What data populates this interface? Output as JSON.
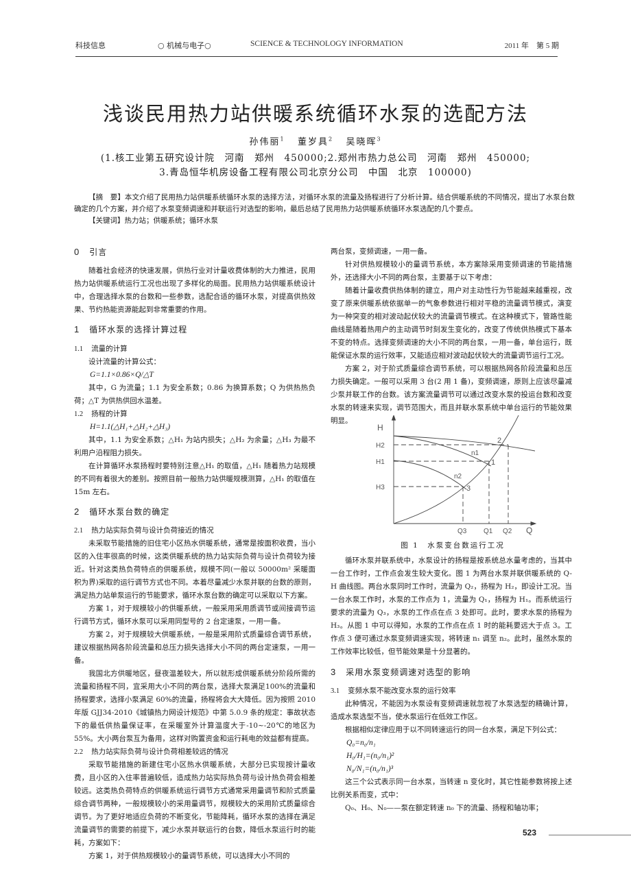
{
  "header": {
    "journal_cn": "科技信息",
    "section": "○ 机械与电子○",
    "journal_en": "SCIENCE & TECHNOLOGY INFORMATION",
    "issue": "2011 年　第 5 期"
  },
  "article": {
    "title": "浅谈民用热力站供暖系统循环水泵的选配方法",
    "authors": [
      {
        "name": "孙伟丽",
        "sup": "1"
      },
      {
        "name": "董岁具",
        "sup": "2"
      },
      {
        "name": "吴晓晖",
        "sup": "3"
      }
    ],
    "affiliation_line1": "(1.核工业第五研究设计院　河南　郑州　450000;2.郑州市热力总公司　河南　郑州　450000;",
    "affiliation_line2": "3.青岛恒华机房设备工程有限公司北京分公司　中国　北京　100000)",
    "abstract_label": "【摘　要】",
    "abstract": "本文介绍了民用热力站供暖系统循环水泵的选择方法，对循环水泵的流量及扬程进行了分析计算。结合供暖系统的不同情况，提出了水泵台数确定的几个方案，并介绍了水泵变频调速和并联运行对选型的影响，最后总结了民用热力站供暖系统循环水泵选配的几个要点。",
    "keywords_label": "【关键词】",
    "keywords": "热力站；供暖系统；循环水泵"
  },
  "left_column": {
    "s0_num": "0",
    "s0_title": "引言",
    "s0_p1": "随着社会经济的快速发展，供热行业对计量收费体制的大力推进，民用热力站供暖系统运行工况也出现了多样化的局面。民用热力站供暖系统设计中，合理选择水泵的台数和一些参数，选配合适的循环水泵，对提高供热效果、节约热能资源能起到非常重要的作用。",
    "s1_num": "1",
    "s1_title": "循环水泵的选择计算过程",
    "s11_num": "1.1",
    "s11_title": "流量的计算",
    "s11_p1": "设计流量的计算公式：",
    "s11_formula": "G=1.1×0.86×Q/△T",
    "s11_p2": "其中，G 为流量；1.1 为安全系数；0.86 为换算系数；Q 为供热热负荷；△T 为供热供回水温差。",
    "s12_num": "1.2",
    "s12_title": "扬程的计算",
    "s12_formula": "H=1.1(△H₁+△H₂+△H₃)",
    "s12_p1": "其中，1.1 为安全系数；△H₁ 为站内损失；△H₂ 为余量；△H₃ 为最不利用户沿程阻力损失。",
    "s12_p2": "在计算循环水泵扬程时要特别注意△H₁ 的取值，△H₁ 随着热力站规模的不同有着很大的差别。按照目前一般热力站供暖规模测算，△H₁ 的取值在 15m 左右。",
    "s2_num": "2",
    "s2_title": "循环水泵台数的确定",
    "s21_num": "2.1",
    "s21_title": "热力站实际负荷与设计负荷接近的情况",
    "s21_p1": "未采取节能措施的旧住宅小区热水供暖系统，通常是按面积收费，当小区的入住率很高的时候，这类供暖系统的热力站实际负荷与设计负荷较为接近。针对这类热负荷特点的供暖系统，规模不同(一般以 50000m² 采暖面积为界)采取的运行调节方式也不同。本着尽量减少水泵并联的台数的原则，满足热力站单泵运行的节能要求，循环水泵台数的确定可以采取以下方案。",
    "s21_p2": "方案 1，对于规模较小的供暖系统，一般采用采用质调节或间接调节运行调节方式，循环水泵可以采用同型号的 2 台定速泵，一用一备。",
    "s21_p3": "方案 2，对于规模较大供暖系统，一般是采用阶式质量综合调节系统，建议根据热网各阶段流量和总压力损失选择大小不同的两台定速泵，一用一备。",
    "s21_p4": "我国北方供暖地区，昼夜温差较大，所以就形成供暖系统分阶段所需的流量和扬程不同，宜采用大小不同的两台泵，选择大泵满足100%的流量和扬程要求，选择小泵满足 60%的流量，扬程将会大大降低。因为按照 2010 年版 GJJ34-2010《城镇热力网设计规范》中第 5.0.9 条的规定：事故状态下的最低供热量保证率，在采暖室外计算温度大于-10~-20℃的地区为 55%。大小两台泵互为备用，这样对购置资金和运行耗电的效益都有提高。",
    "s22_num": "2.2",
    "s22_title": "热力站实际负荷与设计负荷相差较远的情况",
    "s22_p1": "采取节能措施的新建住宅小区热水供暖系统，大部分已实现按计量收费，且小区的入住率普遍较低，造成热力站实际热负荷与设计热负荷会相差较远。这类热负荷特点的供暖系统运行调节方式通常采用量调节和阶式质量综合调节两种，一般规模较小的采用量调节，规模较大的采用阶式质量综合调节。为了更好地适应负荷的不断变化，节能降耗，循环水泵的选择在满足流量调节的需要的前提下，减少水泵并联运行的台数，降低水泵运行时的能耗，方案如下：",
    "s22_p2": "方案 1，对于供热规模较小的量调节系统，可以选择大小不同的"
  },
  "right_column": {
    "p1": "两台泵，变频调速，一用一备。",
    "p2": "针对供热规模较小的量调节系统，本方案除采用变频调速的节能措施外，还选择大小不同的两台泵，主要基于以下考虑：",
    "p3": "随着计量收费供热体制的建立，用户对主动性行为节能越来越重视，改变了原来供暖系统依据单一的气象参数进行相对平稳的流量调节模式，演变为一种突变的相对波动起伏较大的流量调节模式。在这种模式下，管路性能曲线是随着热用户的主动调节时刻发生变化的，改变了传统供热模式下基本不变的特点。选择变频调速的大小不同的两台泵，一用一备，单台运行，既能保证水泵的运行效率，又能适应相对波动起伏较大的流量调节运行工况。",
    "p4": "方案 2，对于阶式质量综合调节系统，可以根据热网各阶段流量和总压力损失确定。一般可以采用 3 台(2 用 1 备)，变频调速，原则上应该尽量减少泵并联工作的台数。该方案流量调节可以通过改变水泵的投运台数和改变水泵的转速来实现，调节范围大，而且并联水泵系统中单台运行的节能效果明显。",
    "figure_caption": "图 1　水泵变台数运行工况",
    "p5": "循环水泵并联系统中，水泵设计的扬程是按系统总水量考虑的，当其中一台工作时，工作点会发生较大变化。图 1 为两台水泵并联供暖系统的 Q-H 曲线图。两台水泵同时工作时，流量为 Q₂，扬程为 H₂，即设计工况。当一台水泵工作时，水泵的工作点为 1，流量为 Q₁，扬程为 H₁。而系统运行要求的流量为 Q₃，水泵的工作点在点 3 处即可。此时，要求水泵的扬程为 H₃。从图 1 中可以得知，水泵的工作点在点 1 时的能耗要远大于点 3。工作点 3 便可通过水泵变频调速实现，将转速 n₁ 调至 n₂。此时，虽然水泵的工作效率比较低，但节能效果是十分显著的。",
    "s3_num": "3",
    "s3_title": "采用水泵变频调速对选型的影响",
    "s31_num": "3.1",
    "s31_title": "变频水泵不能改变水泵的运行效率",
    "p6": "此种情况，不能因为水泵设有变频调速就忽视了水泵选型的精确计算，造成水泵选型不当，使水泵运行在低效工作区。",
    "p7": "根据相似定律应用于以不同转速运行的同一台水泵，满足下列公式：",
    "f1": "Q₀=n₀/n₁",
    "f2": "H₀/H₁=(n₀/n₁)²",
    "f3": "N₀/N₁=(n₀/n₁)³",
    "p8": "这三个公式表示同一台水泵，当转速 n 变化时，其它性能参数将按上述比例关系而变，式中：",
    "p9": "Q₀、H₀、N₀——泵在额定转速 n₀ 下的流量、扬程和轴功率；"
  },
  "figure": {
    "x_axis_label": "Q",
    "y_axis_label": "H",
    "y_ticks": [
      "H2",
      "H1",
      "H3"
    ],
    "x_ticks": [
      "Q3",
      "Q1",
      "Q2"
    ],
    "curve_labels": [
      "n1",
      "n2"
    ],
    "points": [
      "1",
      "2",
      "3"
    ]
  },
  "footer": {
    "page_number": "523"
  }
}
